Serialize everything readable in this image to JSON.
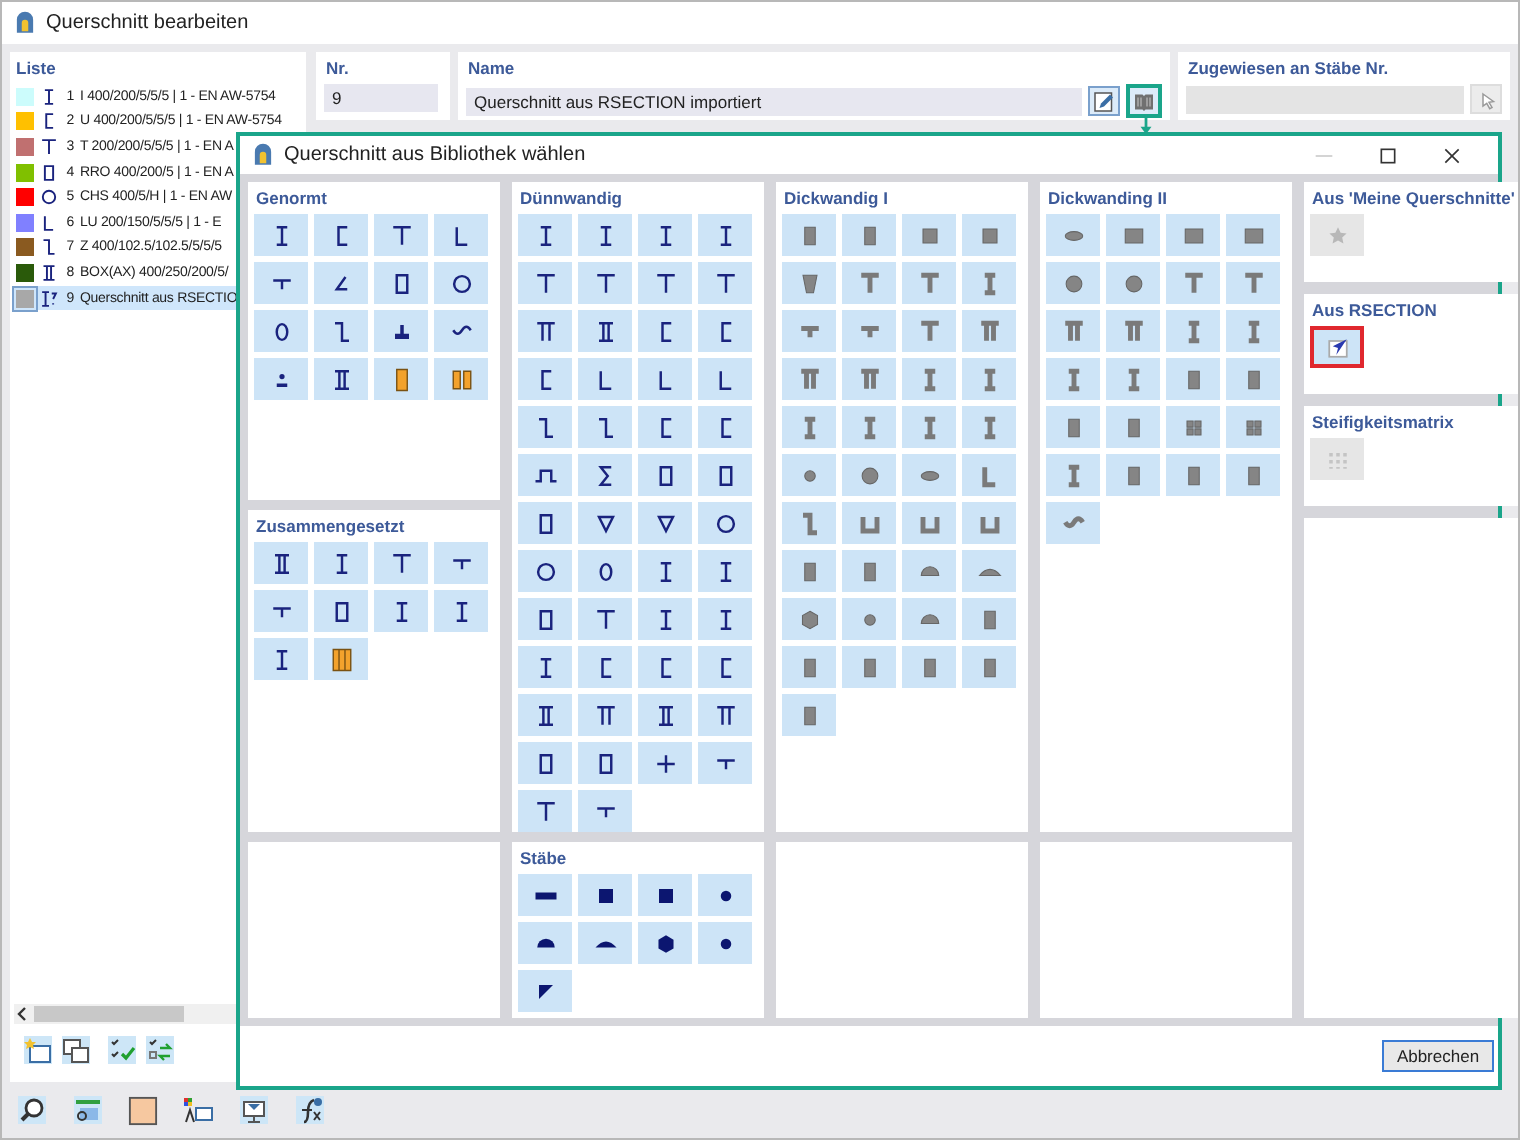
{
  "window": {
    "title": "Querschnitt bearbeiten"
  },
  "list": {
    "title": "Liste",
    "items": [
      {
        "number": "1",
        "text": "I 400/200/5/5/5 | 1 - EN AW-5754",
        "color": "#ccfcfc",
        "kind": "i",
        "selected": false
      },
      {
        "number": "2",
        "text": "U 400/200/5/5/5 | 1 - EN AW-5754",
        "color": "#ffc000",
        "kind": "c",
        "selected": false
      },
      {
        "number": "3",
        "text": "T 200/200/5/5/5 | 1 - EN A",
        "color": "#c07070",
        "kind": "t",
        "selected": false
      },
      {
        "number": "4",
        "text": "RRO 400/200/5 | 1 - EN A",
        "color": "#80c000",
        "kind": "box",
        "selected": false
      },
      {
        "number": "5",
        "text": "CHS 400/5/H | 1 - EN AW",
        "color": "#ff0000",
        "kind": "o",
        "selected": false
      },
      {
        "number": "6",
        "text": "LU 200/150/5/5/5 | 1 - E",
        "color": "#8080ff",
        "kind": "l",
        "selected": false
      },
      {
        "number": "7",
        "text": "Z 400/102.5/102.5/5/5/5",
        "color": "#8a5a20",
        "kind": "z",
        "selected": false
      },
      {
        "number": "8",
        "text": "BOX(AX) 400/250/200/5/",
        "color": "#2a5a0a",
        "kind": "ii",
        "selected": false
      },
      {
        "number": "9",
        "text": "Querschnitt aus RSECTIO",
        "color": "#a8a8a8",
        "kind": "custom",
        "selected": true
      }
    ]
  },
  "number_field": {
    "label": "Nr.",
    "value": "9"
  },
  "name_field": {
    "label": "Name",
    "value": "Querschnitt aus RSECTION importiert"
  },
  "assigned_field": {
    "label": "Zugewiesen an Stäbe Nr.",
    "disabled": true
  },
  "dialog": {
    "title": "Querschnitt aus Bibliothek wählen",
    "panels": [
      {
        "title": "Genormt",
        "kind": "thin",
        "tiles": [
          {
            "kind": "i"
          },
          {
            "kind": "c"
          },
          {
            "kind": "t"
          },
          {
            "kind": "l"
          },
          {
            "kind": "tinv"
          },
          {
            "kind": "angle"
          },
          {
            "kind": "box"
          },
          {
            "kind": "o"
          },
          {
            "kind": "oval"
          },
          {
            "kind": "z"
          },
          {
            "kind": "rail"
          },
          {
            "kind": "wave"
          },
          {
            "kind": "dot"
          },
          {
            "kind": "ii"
          },
          {
            "kind": "orange"
          },
          {
            "kind": "orange2"
          }
        ]
      },
      {
        "title": "Zusammengesetzt",
        "kind": "thin",
        "tiles": [
          {
            "kind": "ii"
          },
          {
            "kind": "i"
          },
          {
            "kind": "t"
          },
          {
            "kind": "tinv"
          },
          {
            "kind": "tinv"
          },
          {
            "kind": "box"
          },
          {
            "kind": "i"
          },
          {
            "kind": "i"
          },
          {
            "kind": "i"
          },
          {
            "kind": "orange3"
          }
        ]
      },
      {
        "kind": "empty"
      },
      {
        "title": "Dünnwandig",
        "kind": "thin",
        "tiles": [
          {
            "kind": "i"
          },
          {
            "kind": "i"
          },
          {
            "kind": "i"
          },
          {
            "kind": "i"
          },
          {
            "kind": "t"
          },
          {
            "kind": "t"
          },
          {
            "kind": "t"
          },
          {
            "kind": "t"
          },
          {
            "kind": "pi"
          },
          {
            "kind": "ii"
          },
          {
            "kind": "c"
          },
          {
            "kind": "c"
          },
          {
            "kind": "c"
          },
          {
            "kind": "l"
          },
          {
            "kind": "l"
          },
          {
            "kind": "l"
          },
          {
            "kind": "z"
          },
          {
            "kind": "z"
          },
          {
            "kind": "c"
          },
          {
            "kind": "c"
          },
          {
            "kind": "hat"
          },
          {
            "kind": "sigma"
          },
          {
            "kind": "box"
          },
          {
            "kind": "box"
          },
          {
            "kind": "box"
          },
          {
            "kind": "v"
          },
          {
            "kind": "v"
          },
          {
            "kind": "o"
          },
          {
            "kind": "o"
          },
          {
            "kind": "oval"
          },
          {
            "kind": "i"
          },
          {
            "kind": "i"
          },
          {
            "kind": "box"
          },
          {
            "kind": "t"
          },
          {
            "kind": "i"
          },
          {
            "kind": "i"
          },
          {
            "kind": "i"
          },
          {
            "kind": "c"
          },
          {
            "kind": "c"
          },
          {
            "kind": "c"
          },
          {
            "kind": "ii"
          },
          {
            "kind": "pi"
          },
          {
            "kind": "ii"
          },
          {
            "kind": "pi"
          },
          {
            "kind": "box"
          },
          {
            "kind": "box"
          },
          {
            "kind": "plus"
          },
          {
            "kind": "tinv"
          },
          {
            "kind": "t"
          },
          {
            "kind": "tinv"
          }
        ]
      },
      {
        "title": "Stäbe",
        "kind": "bar",
        "tiles": [
          {
            "kind": "flat"
          },
          {
            "kind": "square"
          },
          {
            "kind": "square"
          },
          {
            "kind": "circle"
          },
          {
            "kind": "half"
          },
          {
            "kind": "segment"
          },
          {
            "kind": "hex"
          },
          {
            "kind": "circle"
          },
          {
            "kind": "corner"
          }
        ]
      },
      {
        "title": "Dickwandig I",
        "kind": "solid",
        "tiles": [
          {
            "kind": "box"
          },
          {
            "kind": "box"
          },
          {
            "kind": "square"
          },
          {
            "kind": "square"
          },
          {
            "kind": "taper"
          },
          {
            "kind": "t"
          },
          {
            "kind": "t"
          },
          {
            "kind": "i"
          },
          {
            "kind": "tinv"
          },
          {
            "kind": "tinv"
          },
          {
            "kind": "t"
          },
          {
            "kind": "pi"
          },
          {
            "kind": "pi"
          },
          {
            "kind": "pi"
          },
          {
            "kind": "i"
          },
          {
            "kind": "i"
          },
          {
            "kind": "i"
          },
          {
            "kind": "i"
          },
          {
            "kind": "i"
          },
          {
            "kind": "i"
          },
          {
            "kind": "circle"
          },
          {
            "kind": "o"
          },
          {
            "kind": "ellipse"
          },
          {
            "kind": "l"
          },
          {
            "kind": "z"
          },
          {
            "kind": "u"
          },
          {
            "kind": "u"
          },
          {
            "kind": "u"
          },
          {
            "kind": "box"
          },
          {
            "kind": "box"
          },
          {
            "kind": "half"
          },
          {
            "kind": "segment"
          },
          {
            "kind": "hex"
          },
          {
            "kind": "circle"
          },
          {
            "kind": "half"
          },
          {
            "kind": "box"
          },
          {
            "kind": "box"
          },
          {
            "kind": "box"
          },
          {
            "kind": "box"
          },
          {
            "kind": "box"
          },
          {
            "kind": "box"
          }
        ]
      },
      {
        "kind": "empty"
      },
      {
        "title": "Dickwanding II",
        "kind": "solid",
        "tiles": [
          {
            "kind": "ellipse"
          },
          {
            "kind": "bars"
          },
          {
            "kind": "bars"
          },
          {
            "kind": "bars"
          },
          {
            "kind": "o"
          },
          {
            "kind": "o"
          },
          {
            "kind": "t"
          },
          {
            "kind": "t"
          },
          {
            "kind": "pi"
          },
          {
            "kind": "pi"
          },
          {
            "kind": "i"
          },
          {
            "kind": "i"
          },
          {
            "kind": "i"
          },
          {
            "kind": "i"
          },
          {
            "kind": "box"
          },
          {
            "kind": "box"
          },
          {
            "kind": "box"
          },
          {
            "kind": "box"
          },
          {
            "kind": "grid"
          },
          {
            "kind": "grid"
          },
          {
            "kind": "i"
          },
          {
            "kind": "box"
          },
          {
            "kind": "box"
          },
          {
            "kind": "box"
          },
          {
            "kind": "wave"
          }
        ]
      },
      {
        "kind": "empty"
      }
    ],
    "side_panels": [
      {
        "title": "Aus 'Meine Querschnitte'",
        "tile": {
          "kind": "star",
          "disabled": true,
          "selected": false
        }
      },
      {
        "title": "Aus RSECTION",
        "tile": {
          "kind": "import",
          "disabled": false,
          "selected": true
        }
      },
      {
        "title": "Steifigkeitsmatrix",
        "tile": {
          "kind": "matrix",
          "disabled": true,
          "selected": false
        }
      },
      {
        "kind": "empty"
      }
    ],
    "cancel_button": "Abbrechen"
  }
}
